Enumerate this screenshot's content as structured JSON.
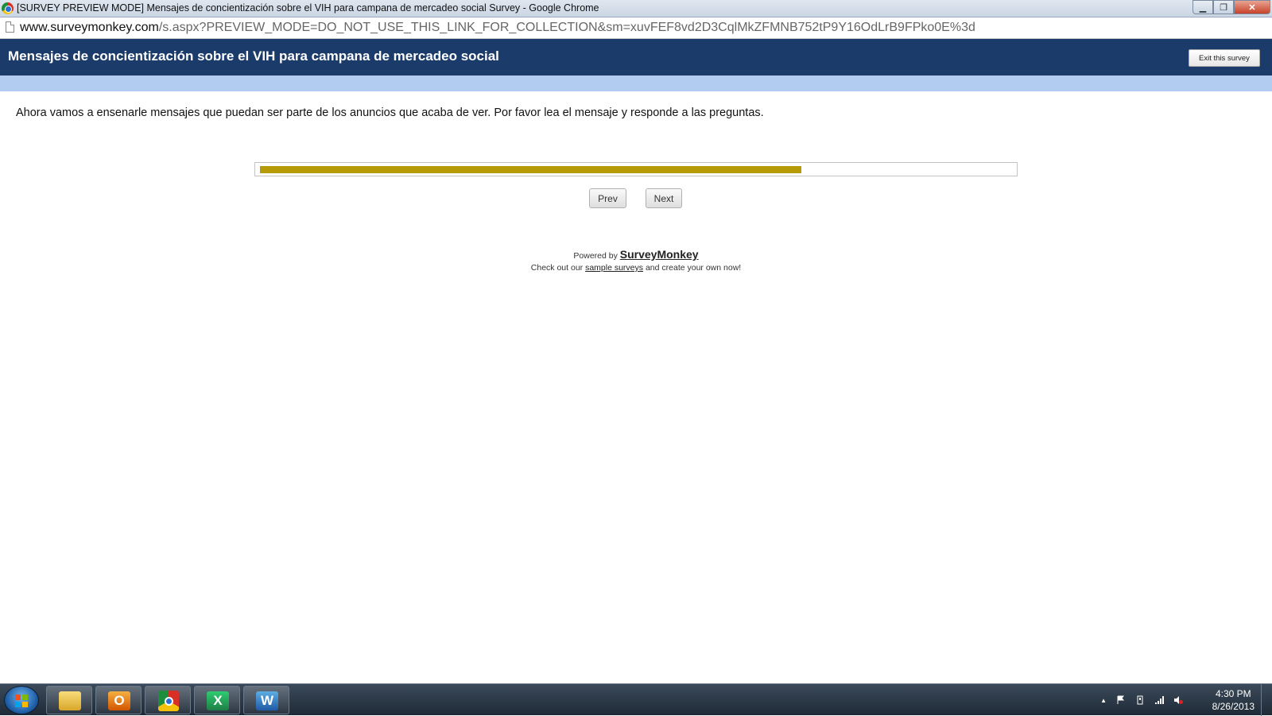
{
  "window": {
    "title": "[SURVEY PREVIEW MODE] Mensajes de concientización sobre el VIH para campana de mercadeo social Survey - Google Chrome",
    "minimize_glyph": "▁",
    "maximize_glyph": "❐",
    "close_glyph": "✕"
  },
  "address": {
    "host": "www.surveymonkey.com",
    "path": "/s.aspx?PREVIEW_MODE=DO_NOT_USE_THIS_LINK_FOR_COLLECTION&sm=xuvFEF8vd2D3CqlMkZFMNB752tP9Y16OdLrB9FPko0E%3d"
  },
  "survey": {
    "title": "Mensajes de concientización sobre el VIH para campana de mercadeo social",
    "exit_label": "Exit this survey",
    "header_color": "#1b3c6b",
    "subheader_color": "#b1cbf1",
    "intro": "Ahora vamos a ensenarle mensajes que puedan ser parte de los anuncios que acaba de ver. Por favor lea el mensaje y responde a las preguntas.",
    "progress_percent": 72,
    "progress_color": "#b79a08",
    "prev_label": "Prev",
    "next_label": "Next"
  },
  "footer": {
    "powered_by": "Powered by",
    "brand": "SurveyMonkey",
    "promo_prefix": "Check out our",
    "promo_link": "sample surveys",
    "promo_suffix": "and create your own now!"
  },
  "taskbar": {
    "apps": [
      "folder-icon",
      "outlook-icon",
      "chrome-icon",
      "excel-icon",
      "word-icon"
    ],
    "excel_letter": "X",
    "word_letter": "W",
    "time": "4:30 PM",
    "date": "8/26/2013",
    "tray_arrow": "▲"
  }
}
